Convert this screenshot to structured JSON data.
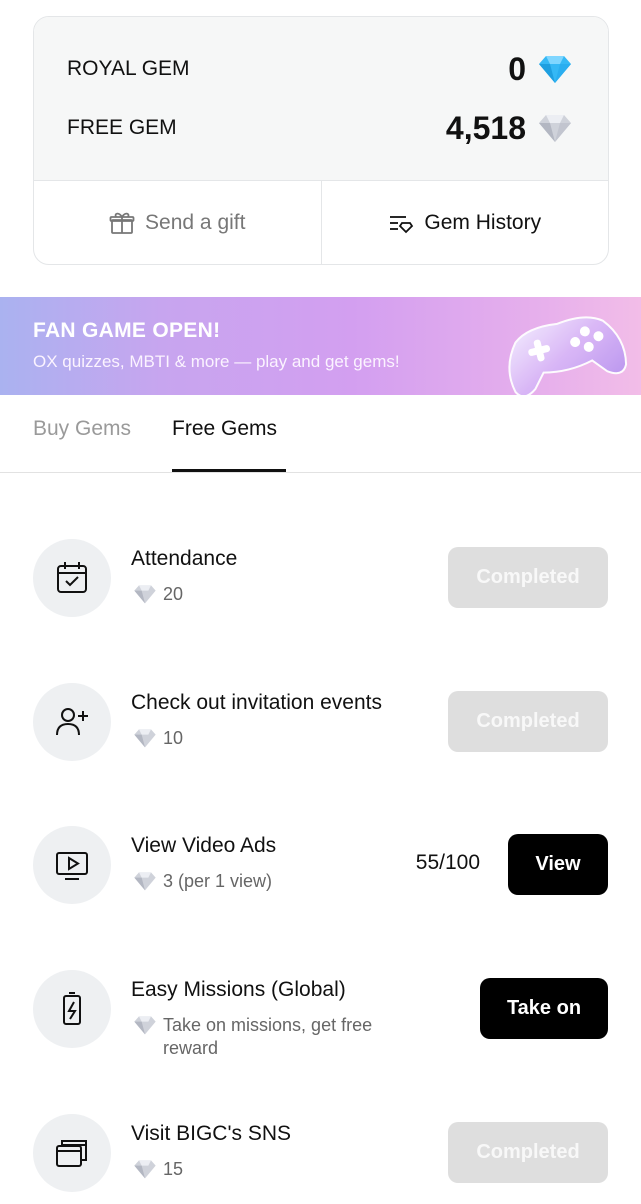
{
  "balance": {
    "royal_label": "ROYAL GEM",
    "royal_value": "0",
    "free_label": "FREE GEM",
    "free_value": "4,518"
  },
  "actions": {
    "send_gift": "Send a gift",
    "gem_history": "Gem History"
  },
  "banner": {
    "title": "FAN GAME OPEN!",
    "subtitle": "OX quizzes, MBTI & more — play and get gems!"
  },
  "tabs": [
    {
      "label": "Buy Gems",
      "active": false
    },
    {
      "label": "Free Gems",
      "active": true
    }
  ],
  "missions": [
    {
      "title": "Attendance",
      "reward": "20",
      "icon": "calendar-check-icon",
      "button": "Completed",
      "state": "completed"
    },
    {
      "title": "Check out invitation events",
      "reward": "10",
      "icon": "add-user-icon",
      "button": "Completed",
      "state": "completed"
    },
    {
      "title": "View Video Ads",
      "reward": "3 (per 1 view)",
      "icon": "video-play-icon",
      "progress": "55/100",
      "button": "View",
      "state": "active"
    },
    {
      "title": "Easy Missions (Global)",
      "reward": "Take on missions, get free reward",
      "icon": "battery-charging-icon",
      "button": "Take on",
      "state": "active"
    },
    {
      "title": "Visit BIGC's SNS",
      "reward": "15",
      "icon": "windows-stack-icon",
      "button": "Completed",
      "state": "completed"
    }
  ],
  "colors": {
    "royal_gem": "#35b8f5",
    "free_gem": "#c9ccd6",
    "completed_button": "#dedede",
    "primary_button": "#000000",
    "banner_gradient_start": "#aab2f0",
    "banner_gradient_end": "#f2bde8"
  }
}
